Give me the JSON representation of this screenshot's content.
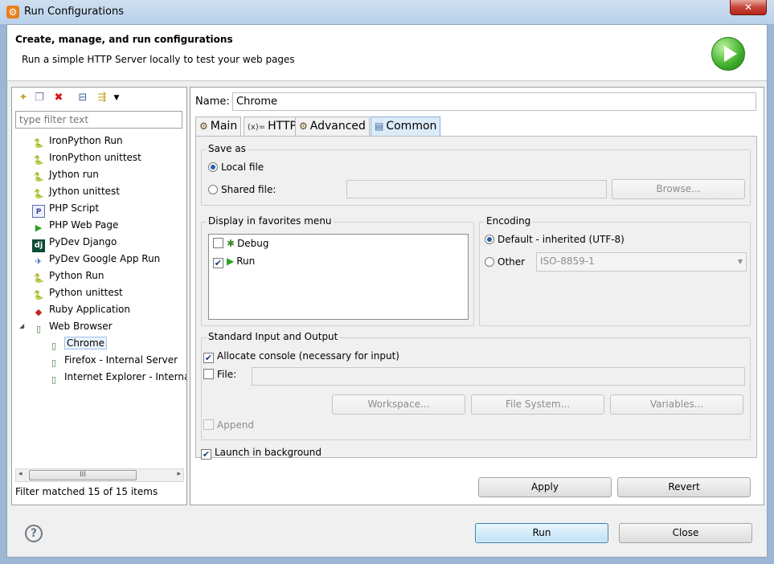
{
  "window": {
    "title": "Run Configurations",
    "close_label": "✕"
  },
  "banner": {
    "title": "Create, manage, and run configurations",
    "subtitle": "Run a simple HTTP Server locally to test your web pages"
  },
  "left": {
    "filter_placeholder": "type filter text",
    "tree": [
      {
        "label": "IronPython Run",
        "icon": "ironpython-icon",
        "glyph": "🐍",
        "level": 1
      },
      {
        "label": "IronPython unittest",
        "icon": "ironpython-unittest-icon",
        "glyph": "🐍",
        "level": 1
      },
      {
        "label": "Jython run",
        "icon": "jython-icon",
        "glyph": "🐍",
        "level": 1
      },
      {
        "label": "Jython unittest",
        "icon": "jython-unittest-icon",
        "glyph": "🐍",
        "level": 1
      },
      {
        "label": "PHP Script",
        "icon": "php-script-icon",
        "glyph": "P",
        "level": 1
      },
      {
        "label": "PHP Web Page",
        "icon": "php-web-page-icon",
        "glyph": "▶",
        "level": 1
      },
      {
        "label": "PyDev Django",
        "icon": "django-icon",
        "glyph": "dj",
        "level": 1
      },
      {
        "label": "PyDev Google App Run",
        "icon": "google-app-icon",
        "glyph": "✈",
        "level": 1
      },
      {
        "label": "Python Run",
        "icon": "python-icon",
        "glyph": "🐍",
        "level": 1
      },
      {
        "label": "Python unittest",
        "icon": "python-unittest-icon",
        "glyph": "🐍",
        "level": 1
      },
      {
        "label": "Ruby Application",
        "icon": "ruby-icon",
        "glyph": "◆",
        "level": 1
      },
      {
        "label": "Web Browser",
        "icon": "web-browser-icon",
        "glyph": "▯",
        "level": 1,
        "expanded": true
      },
      {
        "label": "Chrome",
        "icon": "browser-config-icon",
        "glyph": "▯",
        "level": 2,
        "selected": true
      },
      {
        "label": "Firefox - Internal Server",
        "icon": "browser-config-icon",
        "glyph": "▯",
        "level": 2
      },
      {
        "label": "Internet Explorer - Internal Server",
        "icon": "browser-config-icon",
        "glyph": "▯",
        "level": 2
      }
    ],
    "expand_glyph": "◢",
    "filter_status": "Filter matched 15 of 15 items",
    "scroll_left": "◂",
    "scroll_right": "▸",
    "scroll_grip": "III"
  },
  "right": {
    "name_label": "Name:",
    "name_value": "Chrome",
    "tabs": [
      {
        "label": "Main",
        "icon": "main-tab-icon",
        "glyph": "⚙"
      },
      {
        "label": "HTTP",
        "icon": "http-tab-icon",
        "glyph": "(x)="
      },
      {
        "label": "Advanced",
        "icon": "advanced-tab-icon",
        "glyph": "⚙"
      },
      {
        "label": "Common",
        "icon": "common-tab-icon",
        "glyph": "▤",
        "active": true
      }
    ],
    "save_as": {
      "title": "Save as",
      "local_file": "Local file",
      "shared_file": "Shared file:",
      "browse": "Browse..."
    },
    "favorites": {
      "title": "Display in favorites menu",
      "items": [
        {
          "label": "Debug",
          "checked": false
        },
        {
          "label": "Run",
          "checked": true
        }
      ]
    },
    "encoding": {
      "title": "Encoding",
      "default_label": "Default - inherited (UTF-8)",
      "other_label": "Other",
      "other_value": "ISO-8859-1"
    },
    "stdio": {
      "title": "Standard Input and Output",
      "allocate_console": "Allocate console (necessary for input)",
      "file_label": "File:",
      "workspace": "Workspace...",
      "file_system": "File System...",
      "variables": "Variables...",
      "append": "Append"
    },
    "launch_background": "Launch in background",
    "apply": "Apply",
    "revert": "Revert"
  },
  "footer": {
    "help": "?",
    "run": "Run",
    "close": "Close"
  },
  "colors": {
    "accent_blue": "#2a5da8",
    "run_green": "#3fae2a",
    "close_red": "#c7453a"
  }
}
